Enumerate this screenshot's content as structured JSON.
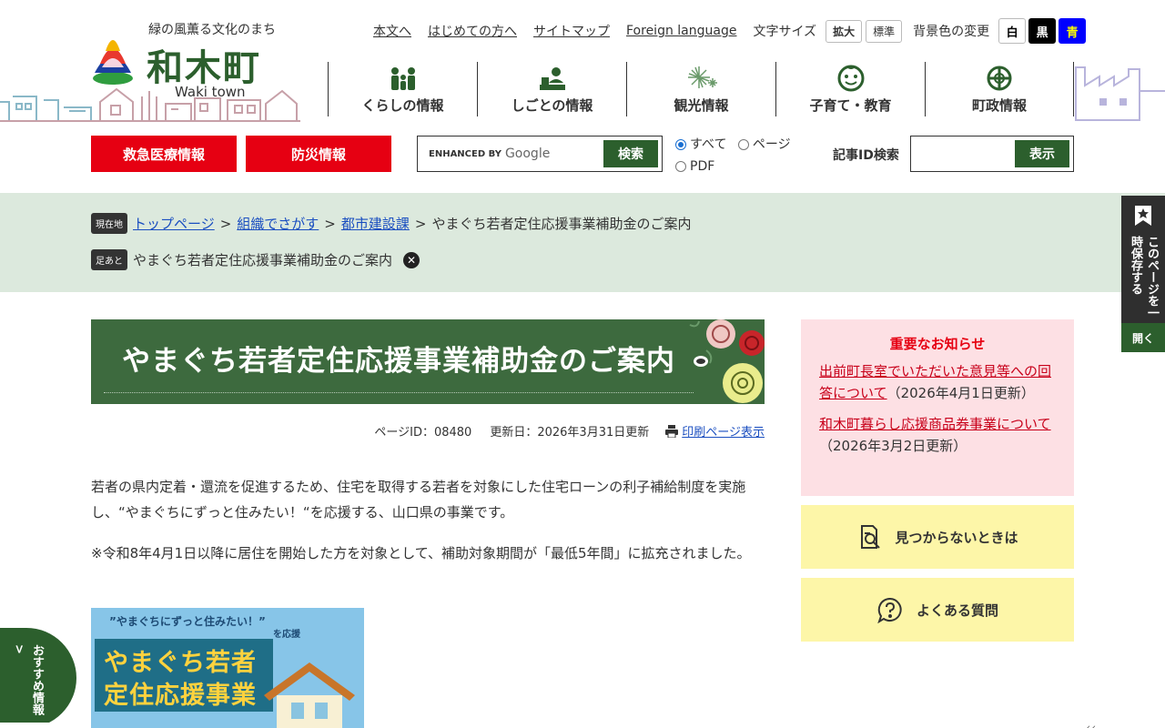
{
  "header": {
    "tagline": "緑の風薫る文化のまち",
    "town_name": "和木町",
    "town_name_en": "Waki town",
    "util_links": [
      "本文へ",
      "はじめての方へ",
      "サイトマップ",
      "Foreign language"
    ],
    "font_size_label": "文字サイズ",
    "font_size_buttons": [
      "拡大",
      "標準"
    ],
    "bg_color_label": "背景色の変更",
    "bg_color_buttons": [
      "白",
      "黒",
      "青"
    ]
  },
  "gnav": [
    {
      "label": "くらしの情報",
      "icon": "family-icon"
    },
    {
      "label": "しごとの情報",
      "icon": "desk-worker-icon"
    },
    {
      "label": "観光情報",
      "icon": "fireworks-icon"
    },
    {
      "label": "子育て・教育",
      "icon": "child-face-icon"
    },
    {
      "label": "町政情報",
      "icon": "town-emblem-icon"
    }
  ],
  "actions": {
    "emergency": "救急医療情報",
    "disaster": "防災情報",
    "search_enhanced": "ENHANCED BY",
    "search_google": "Google",
    "search_button": "検索",
    "radio_all": "すべて",
    "radio_page": "ページ",
    "radio_pdf": "PDF",
    "article_id_label": "記事ID検索",
    "article_id_button": "表示"
  },
  "breadcrumb": {
    "current_tag": "現在地",
    "items": [
      "トップページ",
      "組織でさがす",
      "都市建設課"
    ],
    "current": "やまぐち若者定住応援事業補助金のご案内",
    "sep": ">",
    "footprint_tag": "足あと",
    "footprint_item": "やまぐち若者定住応援事業補助金のご案内"
  },
  "article": {
    "title": "やまぐち若者定住応援事業補助金のご案内",
    "page_id": "ページID：08480",
    "updated": "更新日：2026年3月31日更新",
    "print_link": "印刷ページ表示",
    "para1": "若者の県内定着・還流を促進するため、住宅を取得する若者を対象にした住宅ローンの利子補給制度を実施し、“やまぐちにずっと住みたい！“を応援する、山口県の事業です。",
    "para2": "※令和8年4月1日以降に居住を開始した方を対象として、補助対象期間が「最低5年間」に拡充されました。",
    "promo_top": "”やまぐちにずっと住みたい！”",
    "promo_sub": "を応援",
    "promo_line1": "やまぐち若者",
    "promo_line2": "定住応援事業"
  },
  "sidebar": {
    "notice_title": "重要なお知らせ",
    "notices": [
      {
        "link": "出前町長室でいただいた意見等への回答について",
        "date": "（2026年4月1日更新）"
      },
      {
        "link": "和木町暮らし応援商品券事業について",
        "date": "（2026年3月2日更新）"
      }
    ],
    "not_found": "見つからないときは",
    "faq": "よくある質問"
  },
  "floating": {
    "bookmark_text": "このページを一時保存する",
    "bookmark_open": "開く",
    "reco_text": "おすすめ情報 >"
  },
  "colors": {
    "brand_green": "#2c5f2d",
    "alert_red": "#e60012",
    "breadcrumb_bg": "#dce9dd",
    "notice_bg": "#fde0e4",
    "help_bg": "#fdf6a8"
  }
}
